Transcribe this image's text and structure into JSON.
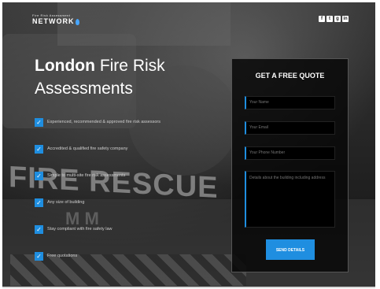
{
  "brand": {
    "tagline": "Fire Risk Assessment",
    "name": "NETWORK"
  },
  "social": [
    "f",
    "t",
    "g",
    "in"
  ],
  "hero": {
    "title_bold": "London",
    "title_rest": "Fire Risk",
    "title_line2": "Assessments"
  },
  "features": [
    "Experienced, recommended & approved fire risk assessors",
    "Accredited & qualified fire safety company",
    "Simple to multi-site fire risk assessments",
    "Any size of building",
    "Stay compliant with fire safety law",
    "Free quotations"
  ],
  "background": {
    "vehicle_text": "FIRE RESCUE"
  },
  "quote_form": {
    "heading": "GET A FREE QUOTE",
    "name_placeholder": "Your Name",
    "email_placeholder": "Your Email",
    "phone_placeholder": "Your Phone Number",
    "details_placeholder": "Details about the building including address",
    "submit_label": "SEND DETAILS"
  },
  "colors": {
    "accent": "#1f8ee0",
    "form_bg": "#080808"
  }
}
